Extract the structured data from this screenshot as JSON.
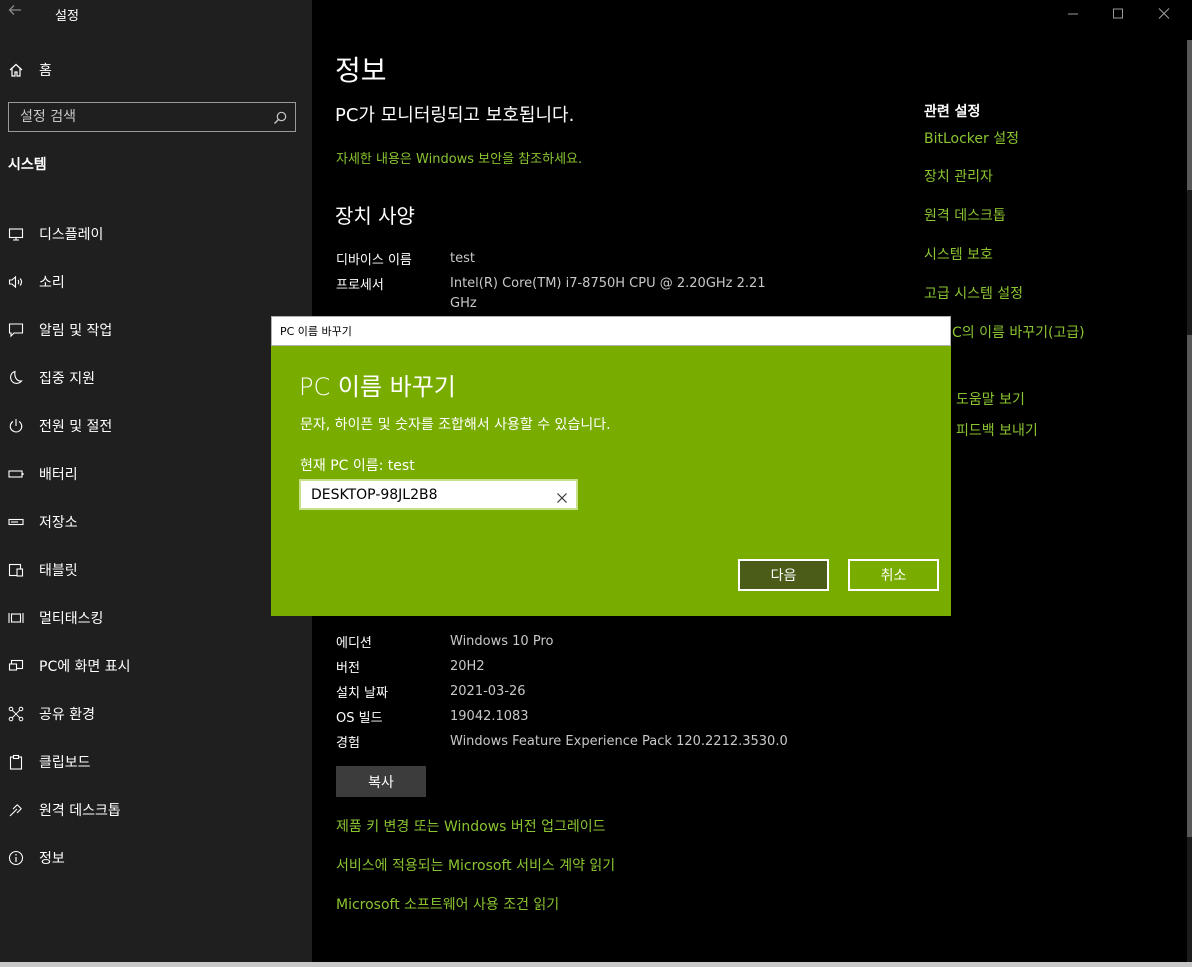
{
  "window": {
    "title": "설정",
    "controls": {
      "minimize": "—",
      "maximize": "☐",
      "close": "✕"
    }
  },
  "sidebar": {
    "home_label": "홈",
    "search_placeholder": "설정 검색",
    "section_title": "시스템",
    "items": [
      {
        "label": "디스플레이",
        "icon": "display-icon"
      },
      {
        "label": "소리",
        "icon": "sound-icon"
      },
      {
        "label": "알림 및 작업",
        "icon": "notification-icon"
      },
      {
        "label": "집중 지원",
        "icon": "focus-assist-icon"
      },
      {
        "label": "전원 및 절전",
        "icon": "power-icon"
      },
      {
        "label": "배터리",
        "icon": "battery-icon"
      },
      {
        "label": "저장소",
        "icon": "storage-icon"
      },
      {
        "label": "태블릿",
        "icon": "tablet-icon"
      },
      {
        "label": "멀티태스킹",
        "icon": "multitasking-icon"
      },
      {
        "label": "PC에 화면 표시",
        "icon": "project-icon"
      },
      {
        "label": "공유 환경",
        "icon": "shared-experiences-icon"
      },
      {
        "label": "클립보드",
        "icon": "clipboard-icon"
      },
      {
        "label": "원격 데스크톱",
        "icon": "remote-desktop-icon"
      },
      {
        "label": "정보",
        "icon": "info-icon"
      }
    ]
  },
  "main": {
    "title": "정보",
    "protection_status": "PC가 모니터링되고 보호됩니다.",
    "security_link": "자세한 내용은 Windows 보안을 참조하세요.",
    "device_specs_title": "장치 사양",
    "device_specs": [
      {
        "key": "디바이스 이름",
        "value": "test"
      },
      {
        "key": "프로세서",
        "value": "Intel(R) Core(TM) i7-8750H CPU @ 2.20GHz   2.21 GHz"
      }
    ],
    "windows_specs": [
      {
        "key": "에디션",
        "value": "Windows 10 Pro"
      },
      {
        "key": "버전",
        "value": "20H2"
      },
      {
        "key": "설치 날짜",
        "value": "2021-03-26"
      },
      {
        "key": "OS 빌드",
        "value": "19042.1083"
      },
      {
        "key": "경험",
        "value": "Windows Feature Experience Pack 120.2212.3530.0"
      }
    ],
    "copy_button": "복사",
    "links": [
      "제품 키 변경 또는 Windows 버전 업그레이드",
      "서비스에 적용되는 Microsoft 서비스 계약 읽기",
      "Microsoft 소프트웨어 사용 조건 읽기"
    ]
  },
  "related": {
    "title": "관련 설정",
    "links": [
      "BitLocker 설정",
      "장치 관리자",
      "원격 데스크톱",
      "시스템 보호",
      "고급 시스템 설정",
      "C의 이름 바꾸기(고급)",
      "도움말 보기",
      "피드백 보내기"
    ]
  },
  "dialog": {
    "titlebar": "PC 이름 바꾸기",
    "heading": "PC 이름 바꾸기",
    "description": "문자, 하이픈 및 숫자를 조합해서 사용할 수 있습니다.",
    "current_name": "현재 PC 이름: test",
    "input_value": "DESKTOP-98JL2B8",
    "next_button": "다음",
    "cancel_button": "취소"
  },
  "colors": {
    "accent_link": "#8ac430",
    "dialog_bg": "#78ad00",
    "sidebar_bg": "#1f1f1f"
  }
}
